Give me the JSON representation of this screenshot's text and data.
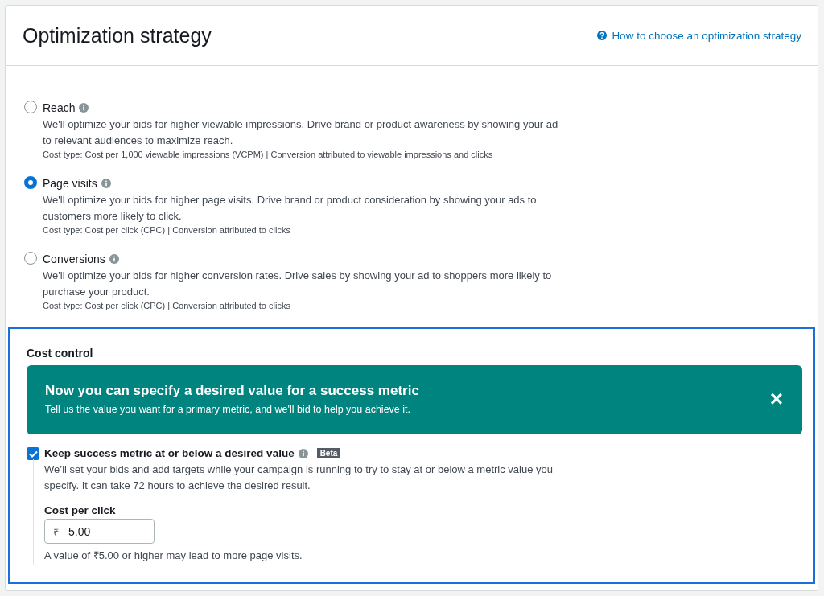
{
  "header": {
    "title": "Optimization strategy",
    "help_link": "How to choose an optimization strategy"
  },
  "options": [
    {
      "label": "Reach",
      "selected": false,
      "description": "We'll optimize your bids for higher viewable impressions. Drive brand or product awareness by showing your ad to relevant audiences to maximize reach.",
      "cost_type": "Cost type: Cost per 1,000 viewable impressions (VCPM) | Conversion attributed to viewable impressions and clicks"
    },
    {
      "label": "Page visits",
      "selected": true,
      "description": "We'll optimize your bids for higher page visits. Drive brand or product consideration by showing your ads to customers more likely to click.",
      "cost_type": "Cost type: Cost per click (CPC) | Conversion attributed to clicks"
    },
    {
      "label": "Conversions",
      "selected": false,
      "description": "We'll optimize your bids for higher conversion rates. Drive sales by showing your ad to shoppers more likely to purchase your product.",
      "cost_type": "Cost type: Cost per click (CPC) | Conversion attributed to clicks"
    }
  ],
  "cost_control": {
    "title": "Cost control",
    "banner": {
      "title": "Now you can specify a desired value for a success metric",
      "text": "Tell us the value you want for a primary metric, and we'll bid to help you achieve it.",
      "close": "×"
    },
    "checkbox": {
      "label": "Keep success metric at or below a desired value",
      "checked": true,
      "badge": "Beta",
      "description": "We’ll set your bids and add targets while your campaign is running to try to stay at or below a metric value you specify. It can take 72 hours to achieve the desired result."
    },
    "field": {
      "label": "Cost per click",
      "prefix": "₹",
      "value": "5.00",
      "hint": "A value of ₹5.00 or higher may lead to more page visits."
    }
  }
}
